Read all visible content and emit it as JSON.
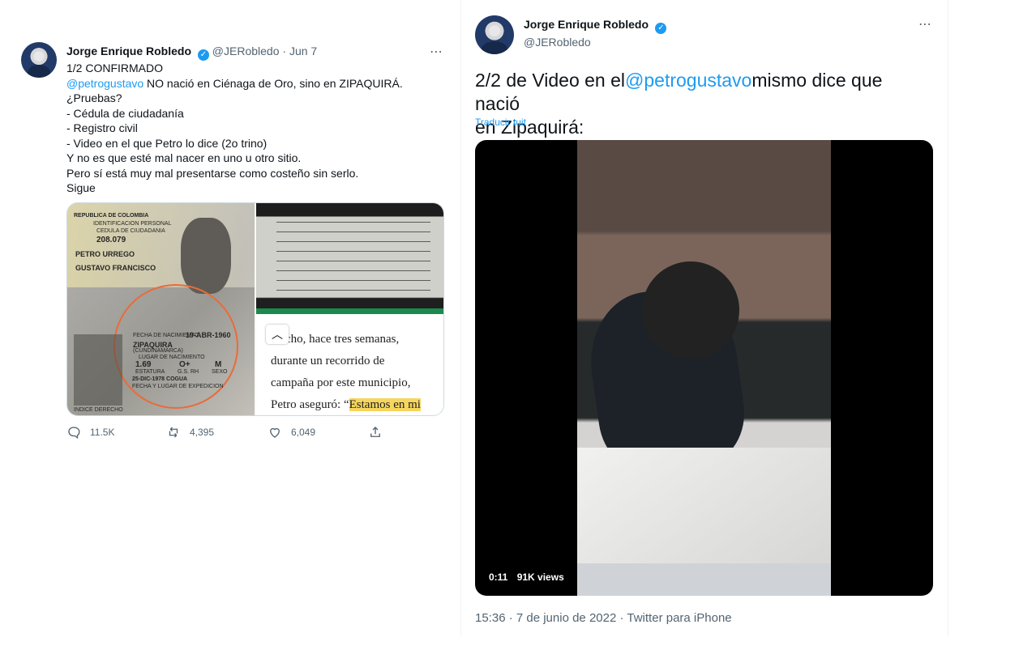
{
  "tweet1": {
    "author": "Jorge Enrique Robledo",
    "handle": "@JERobledo",
    "date": "Jun 7",
    "text_lines": [
      "1/2 CONFIRMADO",
      "NO nació en Ciénaga de Oro, sino en ZIPAQUIRÁ.",
      "¿Pruebas?",
      "- Cédula de ciudadanía",
      "- Registro civil",
      "- Video en el que Petro lo dice (2o trino)",
      "Y no es que esté mal nacer en uno u otro sitio.",
      "Pero sí está muy mal presentarse como costeño sin serlo.",
      "Sigue"
    ],
    "mention": "@petrogustavo",
    "stats": {
      "replies": "11.5K",
      "retweets": "4,395",
      "likes": "6,049"
    },
    "media_text": {
      "card1": "REPUBLICA DE COLOMBIA",
      "card2": "IDENTIFICACION PERSONAL",
      "card3": "CEDULA DE CIUDADANIA",
      "card4": "208.079",
      "card5": "PETRO URREGO",
      "card6": "GUSTAVO FRANCISCO",
      "card7": "FECHA DE NACIMIENTO",
      "card8": "19-ABR-1960",
      "card9": "ZIPAQUIRA",
      "card10": "(CUNDINAMARCA)",
      "card11": "LUGAR DE NACIMIENTO",
      "card12": "1.69",
      "card13": "O+",
      "card14": "M",
      "card15": "ESTATURA",
      "card16": "G.S. RH",
      "card17": "SEXO",
      "card18": "25-DIC-1978 COGUA",
      "card19": "FECHA Y LUGAR DE EXPEDICION",
      "card20": "INDICE DERECHO",
      "news1": "...echo, hace tres semanas,",
      "news2": "durante un recorrido de",
      "news3": "campaña por este municipio,",
      "news4": "Petro aseguró: “",
      "news5": "Estamos en mi"
    }
  },
  "tweet2": {
    "author": "Jorge Enrique Robledo",
    "handle": "@JERobledo",
    "text_a": "2/2 de Video en el",
    "mention": "@petrogustavo",
    "text_b": "mismo dice que nació",
    "text_c": "en Zipaquirá:",
    "translate": "Traducir tuit",
    "video_time": "0:11",
    "video_views": "91K views",
    "timestamp": "15:36 · 7 de junio de 2022",
    "source": "Twitter para iPhone"
  }
}
